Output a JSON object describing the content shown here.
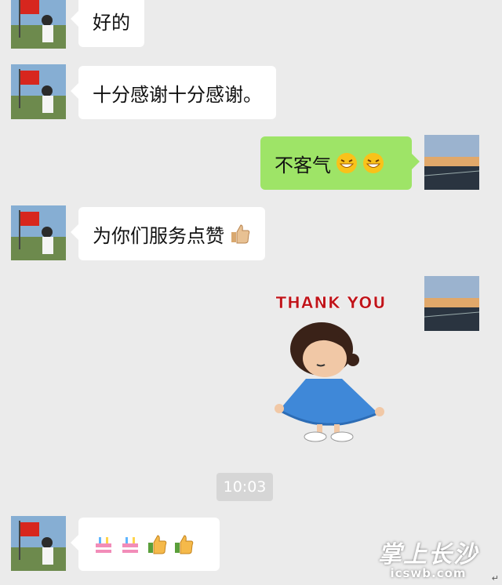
{
  "messages": [
    {
      "side": "in",
      "text": "好的",
      "emojis": []
    },
    {
      "side": "in",
      "text": "十分感谢十分感谢。",
      "emojis": []
    },
    {
      "side": "out",
      "text": "不客气",
      "emojis": [
        "grin-emoji",
        "grin-emoji"
      ]
    },
    {
      "side": "in",
      "text": "为你们服务点赞",
      "emojis": [
        "thumbs-up-emoji"
      ]
    },
    {
      "side": "out",
      "text": "",
      "sticker": "THANK YOU"
    },
    {
      "side": "in",
      "text": "",
      "emojis": [
        "cake-emoji",
        "cake-emoji",
        "thumbs-up-emoji",
        "thumbs-up-emoji"
      ]
    }
  ],
  "timestamp": "10:03",
  "watermark": {
    "title": "掌上长沙",
    "subtitle": "icswb.com"
  },
  "corner_mark": "↵",
  "colors": {
    "background": "#ebebeb",
    "incoming": "#ffffff",
    "outgoing": "#9ee467",
    "time_pill": "#d6d6d6"
  }
}
